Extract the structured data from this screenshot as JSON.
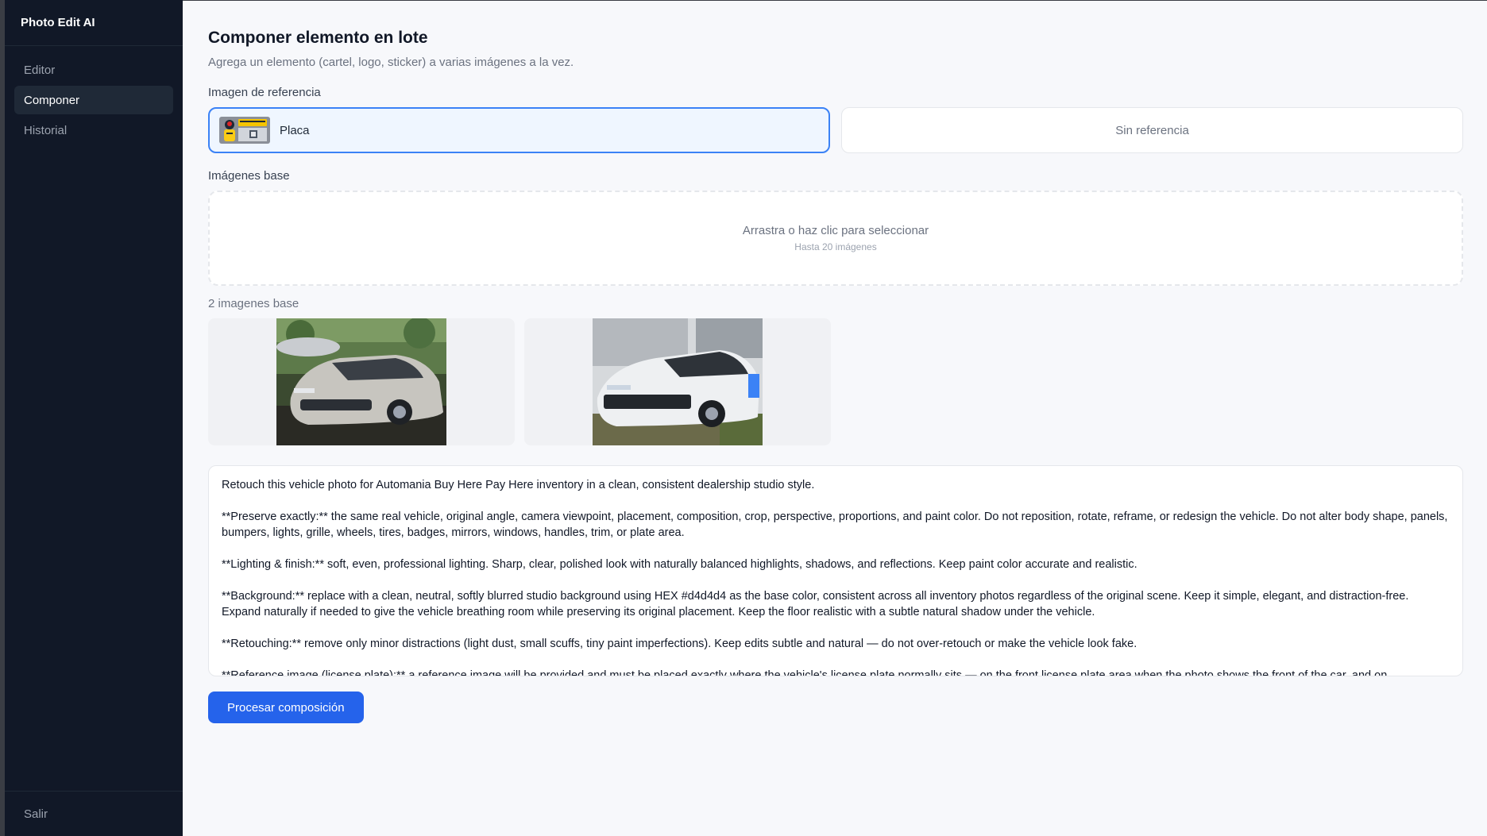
{
  "app": {
    "title": "Photo Edit AI"
  },
  "sidebar": {
    "items": [
      {
        "label": "Editor"
      },
      {
        "label": "Componer"
      },
      {
        "label": "Historial"
      }
    ],
    "logout_label": "Salir"
  },
  "page": {
    "title": "Componer elemento en lote",
    "subtitle": "Agrega un elemento (cartel, logo, sticker) a varias imágenes a la vez."
  },
  "reference": {
    "label": "Imagen de referencia",
    "selected_name": "Placa",
    "selected_thumb_icon": "license-plate-image",
    "none_option": "Sin referencia"
  },
  "base_images": {
    "label": "Imágenes base",
    "dropzone_text": "Arrastra o haz clic para seleccionar",
    "dropzone_hint": "Hasta 20 imágenes",
    "count_label": "2 imagenes base",
    "images": [
      {
        "icon": "silver-sedan-photo"
      },
      {
        "icon": "white-muscle-car-photo"
      }
    ]
  },
  "prompt": {
    "paragraphs": [
      "Retouch this vehicle photo for Automania Buy Here Pay Here inventory in a clean, consistent dealership studio style.",
      "**Preserve exactly:** the same real vehicle, original angle, camera viewpoint, placement, composition, crop, perspective, proportions, and paint color. Do not reposition, rotate, reframe, or redesign the vehicle. Do not alter body shape, panels, bumpers, lights, grille, wheels, tires, badges, mirrors, windows, handles, trim, or plate area.",
      "**Lighting & finish:** soft, even, professional lighting. Sharp, clear, polished look with naturally balanced highlights, shadows, and reflections. Keep paint color accurate and realistic.",
      "**Background:** replace with a clean, neutral, softly blurred studio background using HEX #d4d4d4 as the base color, consistent across all inventory photos regardless of the original scene. Keep it simple, elegant, and distraction-free. Expand naturally if needed to give the vehicle breathing room while preserving its original placement. Keep the floor realistic with a subtle natural shadow under the vehicle.",
      "**Retouching:** remove only minor distractions (light dust, small scuffs, tiny paint imperfections). Keep edits subtle and natural — do not over-retouch or make the vehicle look fake.",
      "**Reference image (license plate):** a reference image will be provided and must be placed exactly where the vehicle's license plate normally sits — on the front license plate area when the photo shows the front of the car, and on"
    ]
  },
  "actions": {
    "process_label": "Procesar composición"
  },
  "colors": {
    "accent": "#2563eb",
    "sidebar_bg": "#111827",
    "page_bg": "#f7f8fb"
  }
}
